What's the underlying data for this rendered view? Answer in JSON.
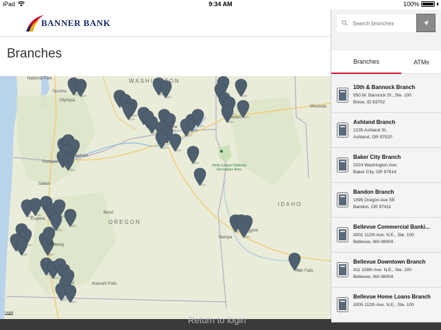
{
  "status_bar": {
    "carrier": "iPad",
    "time": "9:34 AM",
    "battery": "100%"
  },
  "brand": {
    "name": "BANNER BANK",
    "accent": "#c8102e",
    "navy": "#1b2a6b"
  },
  "page": {
    "title": "Branches"
  },
  "map": {
    "legal": "Legal",
    "labels": {
      "washington": "WASHINGTON",
      "oregon": "OREGON",
      "idaho": "IDAHO",
      "olympia": "Olympia",
      "tacoma": "Tacoma",
      "portland": "Portland",
      "gresham": "Gresham",
      "salem": "Salem",
      "eugene": "Eugene",
      "bend": "Bend",
      "roseburg": "Roseburg",
      "medford": "Medford",
      "klamath": "Klamath Falls",
      "missoula": "Missoula",
      "lewiston": "Lewiston",
      "nampa": "Nampa",
      "boise": "Boise",
      "twin_falls": "Twin Falls",
      "national_park": "National Park",
      "hells_canyon": "Hells Canyon National Recreation Area",
      "kennewick": "Kennew"
    },
    "pin_color": "#4e6070"
  },
  "panel": {
    "search_placeholder": "Search branches",
    "tabs": [
      "Branches",
      "ATMs"
    ],
    "branches": [
      {
        "name": "10th & Bannock Branch",
        "line1": "950 W. Bannock St., Ste. 100",
        "line2": "Boise, ID 83702"
      },
      {
        "name": "Ashland Branch",
        "line1": "2235 Ashland St.",
        "line2": "Ashland, OR 97520"
      },
      {
        "name": "Baker City Branch",
        "line1": "2024 Washington Ave.",
        "line2": "Baker City, OR 97814"
      },
      {
        "name": "Bandon Branch",
        "line1": "1095 Oregon Ave SE",
        "line2": "Bandon, OR 97411"
      },
      {
        "name": "Bellevue Commercial Banki...",
        "line1": "3001 112th Ave. N.E., Ste. 100",
        "line2": "Bellevue, WA 98004"
      },
      {
        "name": "Bellevue Downtown Branch",
        "line1": "411 108th Ave. N.E., Ste. 100",
        "line2": "Bellevue, WA 98004"
      },
      {
        "name": "Bellevue Home Loans Branch",
        "line1": "3005 112th Ave. N.E., Ste. 100",
        "line2": ""
      }
    ]
  },
  "footer": {
    "login": "Return to login"
  }
}
